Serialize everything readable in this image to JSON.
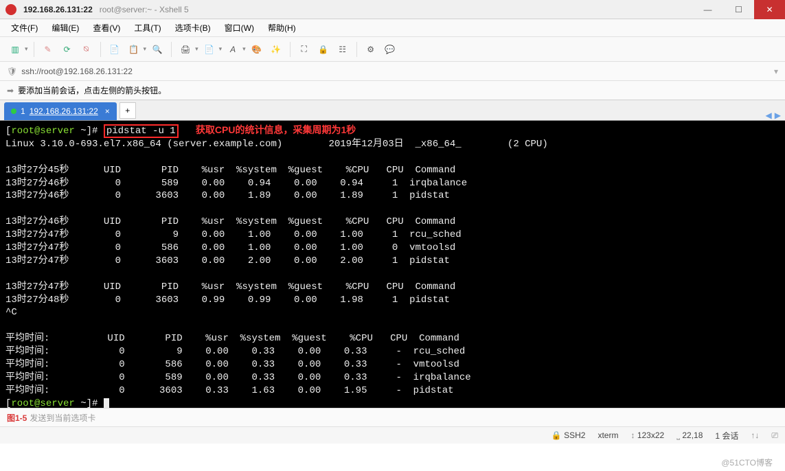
{
  "titlebar": {
    "host_tab": "192.168.26.131:22",
    "subtitle": "root@server:~ - Xshell 5"
  },
  "menubar": {
    "items": [
      "文件(F)",
      "编辑(E)",
      "查看(V)",
      "工具(T)",
      "选项卡(B)",
      "窗口(W)",
      "帮助(H)"
    ]
  },
  "toolbar_icons": [
    "new-session-icon",
    "open-icon",
    "reconnect-icon",
    "paste-icon",
    "properties-icon",
    "copy-icon",
    "search-icon",
    "print-icon",
    "log-icon",
    "font-icon",
    "palette-icon",
    "highlight-icon",
    "fullscreen-icon",
    "tunnel-icon",
    "lock-icon",
    "options-icon",
    "help-icon",
    "chat-icon"
  ],
  "addressbar": {
    "url": "ssh://root@192.168.26.131:22"
  },
  "hintbar": {
    "text": "要添加当前会话，点击左侧的箭头按钮。"
  },
  "tab": {
    "index": "1",
    "label": "192.168.26.131:22"
  },
  "terminal": {
    "prompt_user": "root@server",
    "prompt_path": "~",
    "command": "pidstat -u 1",
    "annotation": "获取CPU的统计信息，采集周期为1秒",
    "kernel_line": "Linux 3.10.0-693.el7.x86_64 (server.example.com)        2019年12月03日  _x86_64_        (2 CPU)",
    "header": "               UID       PID    %usr %system  %guest    %CPU   CPU  Command",
    "blocks": [
      {
        "header_time": "13时27分45秒",
        "rows": [
          {
            "t": "13时27分46秒",
            "uid": "0",
            "pid": "589",
            "usr": "0.00",
            "sys": "0.94",
            "guest": "0.00",
            "cpu": "0.94",
            "cpun": "1",
            "cmd": "irqbalance"
          },
          {
            "t": "13时27分46秒",
            "uid": "0",
            "pid": "3603",
            "usr": "0.00",
            "sys": "1.89",
            "guest": "0.00",
            "cpu": "1.89",
            "cpun": "1",
            "cmd": "pidstat"
          }
        ]
      },
      {
        "header_time": "13时27分46秒",
        "rows": [
          {
            "t": "13时27分47秒",
            "uid": "0",
            "pid": "9",
            "usr": "0.00",
            "sys": "1.00",
            "guest": "0.00",
            "cpu": "1.00",
            "cpun": "1",
            "cmd": "rcu_sched"
          },
          {
            "t": "13时27分47秒",
            "uid": "0",
            "pid": "586",
            "usr": "0.00",
            "sys": "1.00",
            "guest": "0.00",
            "cpu": "1.00",
            "cpun": "0",
            "cmd": "vmtoolsd"
          },
          {
            "t": "13时27分47秒",
            "uid": "0",
            "pid": "3603",
            "usr": "0.00",
            "sys": "2.00",
            "guest": "0.00",
            "cpu": "2.00",
            "cpun": "1",
            "cmd": "pidstat"
          }
        ]
      },
      {
        "header_time": "13时27分47秒",
        "rows": [
          {
            "t": "13时27分48秒",
            "uid": "0",
            "pid": "3603",
            "usr": "0.99",
            "sys": "0.99",
            "guest": "0.00",
            "cpu": "1.98",
            "cpun": "1",
            "cmd": "pidstat"
          }
        ]
      }
    ],
    "interrupt": "^C",
    "avg_label": "平均时间:",
    "avg_header_time": "平均时间:",
    "avg_rows": [
      {
        "uid": "0",
        "pid": "9",
        "usr": "0.00",
        "sys": "0.33",
        "guest": "0.00",
        "cpu": "0.33",
        "cpun": "-",
        "cmd": "rcu_sched"
      },
      {
        "uid": "0",
        "pid": "586",
        "usr": "0.00",
        "sys": "0.33",
        "guest": "0.00",
        "cpu": "0.33",
        "cpun": "-",
        "cmd": "vmtoolsd"
      },
      {
        "uid": "0",
        "pid": "589",
        "usr": "0.00",
        "sys": "0.33",
        "guest": "0.00",
        "cpu": "0.33",
        "cpun": "-",
        "cmd": "irqbalance"
      },
      {
        "uid": "0",
        "pid": "3603",
        "usr": "0.33",
        "sys": "1.63",
        "guest": "0.00",
        "cpu": "1.95",
        "cpun": "-",
        "cmd": "pidstat"
      }
    ],
    "final_prompt_cursor": " "
  },
  "inputbar": {
    "figure_label": "图1-5",
    "hint_suffix": "发送到当前选项卡"
  },
  "statusbar": {
    "protocol_icon": "🔒",
    "protocol": "SSH2",
    "term": "xterm",
    "size_icon": "↕",
    "size": "123x22",
    "pos_icon": "⎵",
    "pos": "22,18",
    "sessions": "1 会话",
    "net_icon": "↑↓",
    "cap_icon": "⎚"
  },
  "watermark": "@51CTO博客"
}
